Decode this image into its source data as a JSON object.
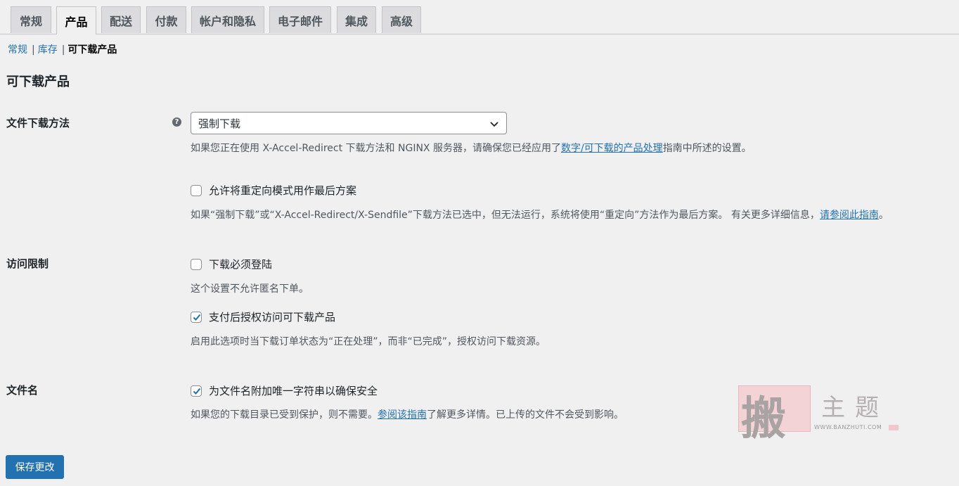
{
  "tabs": [
    {
      "label": "常规",
      "active": false
    },
    {
      "label": "产品",
      "active": true
    },
    {
      "label": "配送",
      "active": false
    },
    {
      "label": "付款",
      "active": false
    },
    {
      "label": "帐户和隐私",
      "active": false
    },
    {
      "label": "电子邮件",
      "active": false
    },
    {
      "label": "集成",
      "active": false
    },
    {
      "label": "高级",
      "active": false
    }
  ],
  "subnav": {
    "items": [
      "常规",
      "库存"
    ],
    "current": "可下载产品",
    "separator": "|"
  },
  "page_title": "可下载产品",
  "download_method": {
    "label": "文件下载方法",
    "help_icon": "question-circle-icon",
    "select_value": "强制下载",
    "desc_before": "如果您正在使用 X-Accel-Redirect 下载方法和 NGINX 服务器，请确保您已经应用了",
    "desc_link": "数字/可下载的产品处理",
    "desc_after": "指南中所述的设置。",
    "redirect_checkbox": {
      "label": "允许将重定向模式用作最后方案",
      "checked": false
    },
    "redirect_desc_before": "如果“强制下载”或“X-Accel-Redirect/X-Sendfile”下载方法已选中，但无法运行，系统将使用“重定向”方法作为最后方案。 有关更多详细信息，",
    "redirect_desc_link": "请参阅此指南",
    "redirect_desc_after": "。"
  },
  "access": {
    "label": "访问限制",
    "login_checkbox": {
      "label": "下载必须登陆",
      "checked": false
    },
    "login_desc": "这个设置不允许匿名下单。",
    "grant_checkbox": {
      "label": "支付后授权访问可下载产品",
      "checked": true
    },
    "grant_desc": "启用此选项时当下载订单状态为“正在处理”，而非“已完成”，授权访问下载资源。"
  },
  "filename": {
    "label": "文件名",
    "unique_checkbox": {
      "label": "为文件名附加唯一字符串以确保安全",
      "checked": true
    },
    "desc_before": "如果您的下载目录已受到保护，则不需要。",
    "desc_link": "参阅该指南",
    "desc_after": "了解更多详情。已上传的文件不会受到影响。"
  },
  "save_button": "保存更改",
  "watermark": {
    "big_char": "搬",
    "text": "主题",
    "url": "WWW.BANZHUTI.COM"
  },
  "colors": {
    "accent": "#2271b1",
    "background": "#f0f0f1",
    "tab_inactive": "#dcdcde",
    "text": "#1d2327",
    "muted": "#50575e"
  }
}
